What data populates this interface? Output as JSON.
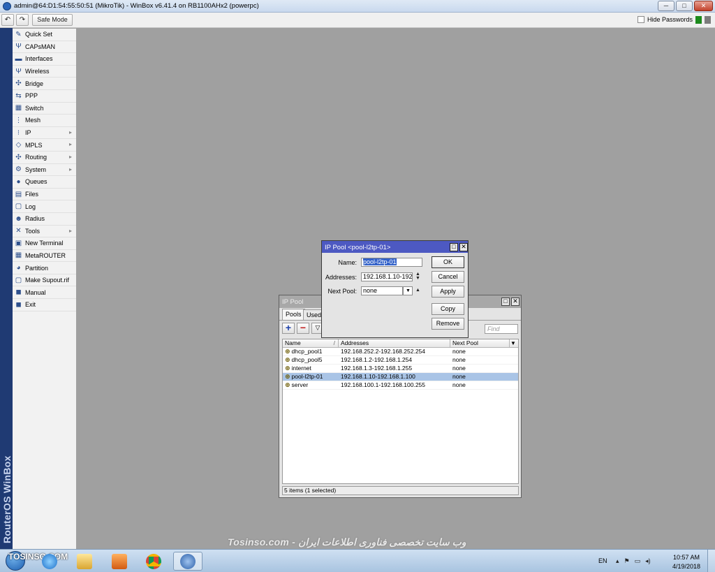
{
  "window": {
    "title": "admin@64:D1:54:55:50:51 (MikroTik) - WinBox v6.41.4 on RB1100AHx2 (powerpc)",
    "btn_minimize": "─",
    "btn_maximize": "□",
    "btn_close": "✕"
  },
  "toolbar": {
    "undo_icon": "↶",
    "redo_icon": "↷",
    "safe_mode_label": "Safe Mode",
    "hide_passwords_label": "Hide Passwords"
  },
  "brand": "RouterOS WinBox",
  "menu": {
    "items": [
      {
        "label": "Quick Set",
        "icon": "✎",
        "arrow": ""
      },
      {
        "label": "CAPsMAN",
        "icon": "Ψ",
        "arrow": ""
      },
      {
        "label": "Interfaces",
        "icon": "▬",
        "arrow": ""
      },
      {
        "label": "Wireless",
        "icon": "Ψ",
        "arrow": ""
      },
      {
        "label": "Bridge",
        "icon": "✣",
        "arrow": ""
      },
      {
        "label": "PPP",
        "icon": "⇆",
        "arrow": ""
      },
      {
        "label": "Switch",
        "icon": "▦",
        "arrow": ""
      },
      {
        "label": "Mesh",
        "icon": "⋮",
        "arrow": ""
      },
      {
        "label": "IP",
        "icon": "⁝",
        "arrow": "▸"
      },
      {
        "label": "MPLS",
        "icon": "◇",
        "arrow": "▸"
      },
      {
        "label": "Routing",
        "icon": "✣",
        "arrow": "▸"
      },
      {
        "label": "System",
        "icon": "⚙",
        "arrow": "▸"
      },
      {
        "label": "Queues",
        "icon": "●",
        "arrow": ""
      },
      {
        "label": "Files",
        "icon": "▤",
        "arrow": ""
      },
      {
        "label": "Log",
        "icon": "▢",
        "arrow": ""
      },
      {
        "label": "Radius",
        "icon": "☻",
        "arrow": ""
      },
      {
        "label": "Tools",
        "icon": "✕",
        "arrow": "▸"
      },
      {
        "label": "New Terminal",
        "icon": "▣",
        "arrow": ""
      },
      {
        "label": "MetaROUTER",
        "icon": "▦",
        "arrow": ""
      },
      {
        "label": "Partition",
        "icon": "◕",
        "arrow": ""
      },
      {
        "label": "Make Supout.rif",
        "icon": "▢",
        "arrow": ""
      },
      {
        "label": "Manual",
        "icon": "◼",
        "arrow": ""
      },
      {
        "label": "Exit",
        "icon": "◼",
        "arrow": ""
      }
    ]
  },
  "pool_window": {
    "title": "IP Pool",
    "tabs": [
      "Pools",
      "Used"
    ],
    "find_placeholder": "Find",
    "columns": [
      "Name",
      "Addresses",
      "Next Pool"
    ],
    "sort_mark": "/",
    "rows": [
      {
        "name": "dhcp_pool1",
        "addresses": "192.168.252.2-192.168.252.254",
        "next_pool": "none",
        "selected": false
      },
      {
        "name": "dhcp_pool5",
        "addresses": "192.168.1.2-192.168.1.254",
        "next_pool": "none",
        "selected": false
      },
      {
        "name": "internet",
        "addresses": "192.168.1.3-192.168.1.255",
        "next_pool": "none",
        "selected": false
      },
      {
        "name": "pool-l2tp-01",
        "addresses": "192.168.1.10-192.168.1.100",
        "next_pool": "none",
        "selected": true
      },
      {
        "name": "server",
        "addresses": "192.168.100.1-192.168.100.255",
        "next_pool": "none",
        "selected": false
      }
    ],
    "status": "5 items (1 selected)"
  },
  "pool_dialog": {
    "title": "IP Pool <pool-l2tp-01>",
    "name_label": "Name:",
    "name_value": "pool-l2tp-01",
    "addresses_label": "Addresses:",
    "addresses_value": "192.168.1.10-192.",
    "next_pool_label": "Next Pool:",
    "next_pool_value": "none",
    "buttons": {
      "ok": "OK",
      "cancel": "Cancel",
      "apply": "Apply",
      "copy": "Copy",
      "remove": "Remove"
    }
  },
  "watermark": "Tosinso.com - وب سایت تخصصی فناوری اطلاعات ایران",
  "taskbar": {
    "logo_text": "TOSINSO.COM",
    "language": "EN",
    "time": "10:57 AM",
    "date": "4/19/2018"
  }
}
